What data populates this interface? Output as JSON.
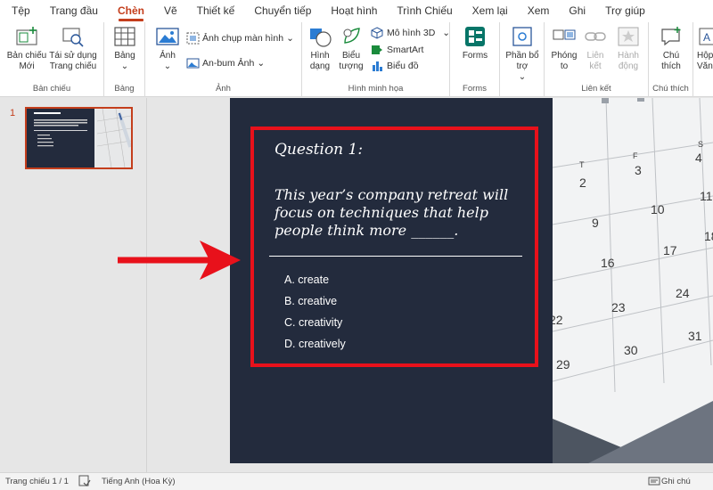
{
  "tabs": [
    "Tệp",
    "Trang đầu",
    "Chèn",
    "Vẽ",
    "Thiết kế",
    "Chuyển tiếp",
    "Hoạt hình",
    "Trình Chiếu",
    "Xem lại",
    "Xem",
    "Ghi",
    "Trợ giúp"
  ],
  "active_tab": "Chèn",
  "ribbon": {
    "slides": {
      "new_slide": "Bản chiếu Mới",
      "reuse": "Tái sử dụng Trang chiếu",
      "label": "Bản chiếu"
    },
    "tables": {
      "table": "Bảng",
      "label": "Bảng"
    },
    "images": {
      "pictures": "Ảnh",
      "screenshot": "Ảnh chụp màn hình",
      "album": "An-bum Ảnh",
      "label": "Ảnh"
    },
    "illustrations": {
      "shapes": "Hình dạng",
      "icons": "Biểu tượng",
      "models3d": "Mô hình 3D",
      "smartart": "SmartArt",
      "chart": "Biểu đồ",
      "label": "Hình minh họa"
    },
    "forms": {
      "forms": "Forms",
      "label": "Forms"
    },
    "addins": {
      "addins": "Phần bổ trợ"
    },
    "links": {
      "zoom": "Phóng to",
      "link": "Liên kết",
      "action": "Hành động",
      "label": "Liên kết"
    },
    "comments": {
      "comment": "Chú thích",
      "label": "Chú thích"
    },
    "text": {
      "textbox": "Hộp Văn"
    }
  },
  "thumbnail": {
    "number": "1"
  },
  "slide": {
    "title": "Question 1:",
    "question": "This year’s company retreat will focus on techniques that help people think more ______.",
    "options": [
      "A. create",
      "B. creative",
      "C. creativity",
      "D. creatively"
    ],
    "calendar_numbers": [
      "T",
      "F",
      "S",
      "2",
      "3",
      "4",
      "9",
      "10",
      "11",
      "16",
      "17",
      "18",
      "23",
      "24",
      "22",
      "30",
      "31",
      "29"
    ]
  },
  "status": {
    "slide_count": "Trang chiếu 1 / 1",
    "language": "Tiếng Anh (Hoa Kỳ)",
    "notes": "Ghi chú"
  },
  "colors": {
    "accent": "#c43e1c",
    "slide_bg": "#232b3d",
    "red_box": "#e8111b"
  }
}
